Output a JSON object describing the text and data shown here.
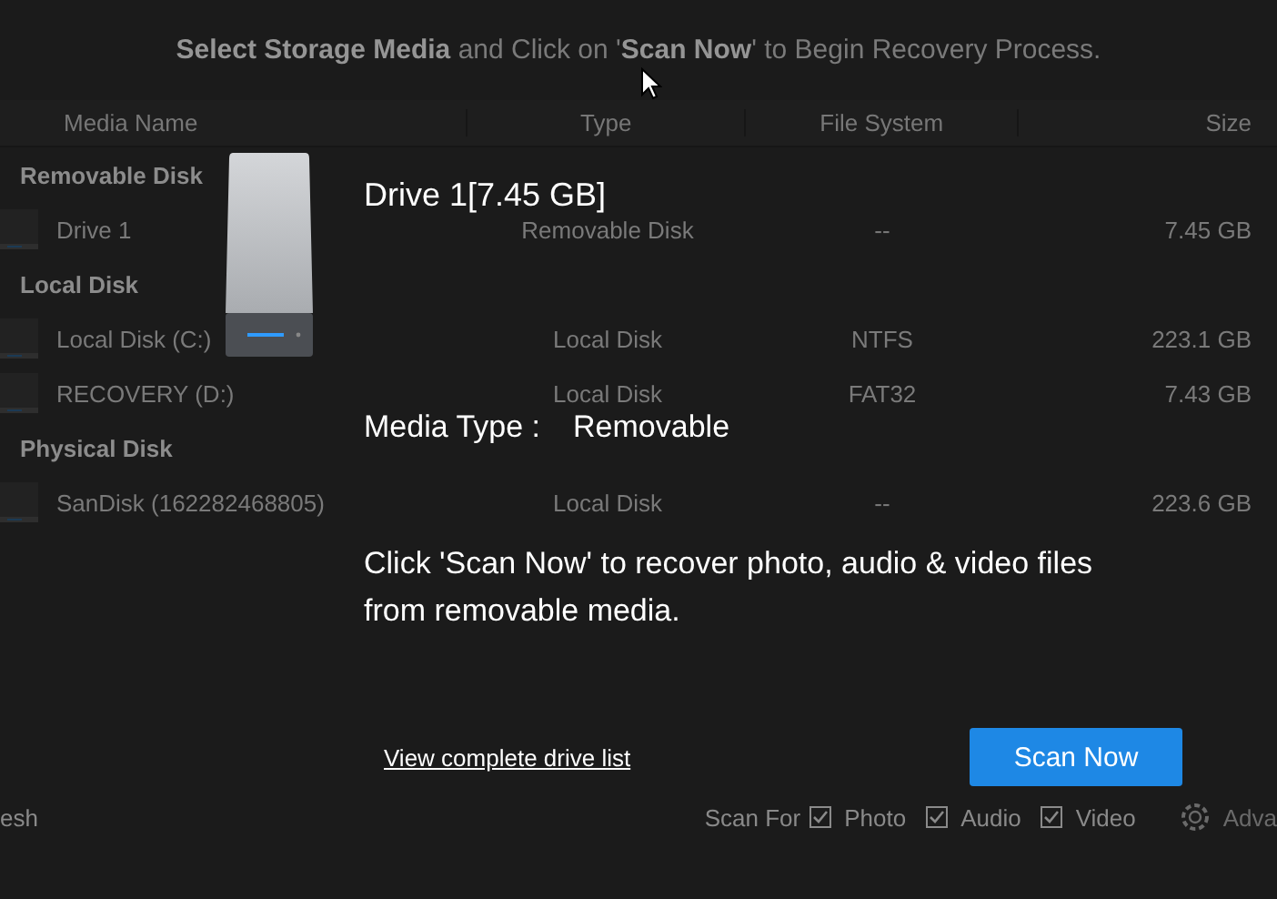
{
  "header": {
    "text": "**Select Storage Media** and Click on '**Scan Now**' to Begin Recovery Process."
  },
  "table": {
    "columns": [
      "Media Name",
      "Type",
      "File System",
      "Size"
    ],
    "groups": [
      {
        "label": "Removable Disk",
        "rows": [
          {
            "name": "Drive 1",
            "type": "Removable Disk",
            "file_system": "--",
            "size": "7.45 GB"
          }
        ]
      },
      {
        "label": "Local Disk",
        "rows": [
          {
            "name": "Local Disk (C:)",
            "type": "Local Disk",
            "file_system": "NTFS",
            "size": "223.1 GB"
          },
          {
            "name": "RECOVERY (D:)",
            "type": "Local Disk",
            "file_system": "FAT32",
            "size": "7.43 GB"
          }
        ]
      },
      {
        "label": "Physical Disk",
        "rows": [
          {
            "name": "SanDisk (162282468805)",
            "type": "Local Disk",
            "file_system": "--",
            "size": "223.6 GB"
          }
        ]
      }
    ]
  },
  "bottom_bar": {
    "refresh": "esh",
    "scan_for": "Scan For",
    "options": [
      {
        "label": "Photo",
        "checked": true
      },
      {
        "label": "Audio",
        "checked": true
      },
      {
        "label": "Video",
        "checked": true
      }
    ],
    "advanced": "Adva"
  },
  "dialog": {
    "title": "Drive 1[7.45 GB]",
    "media_type_label": "Media Type :",
    "media_type": "Removable",
    "description": "Click 'Scan Now' to recover photo, audio & video files from removable media.",
    "link": "View complete drive list",
    "button": "Scan Now"
  }
}
